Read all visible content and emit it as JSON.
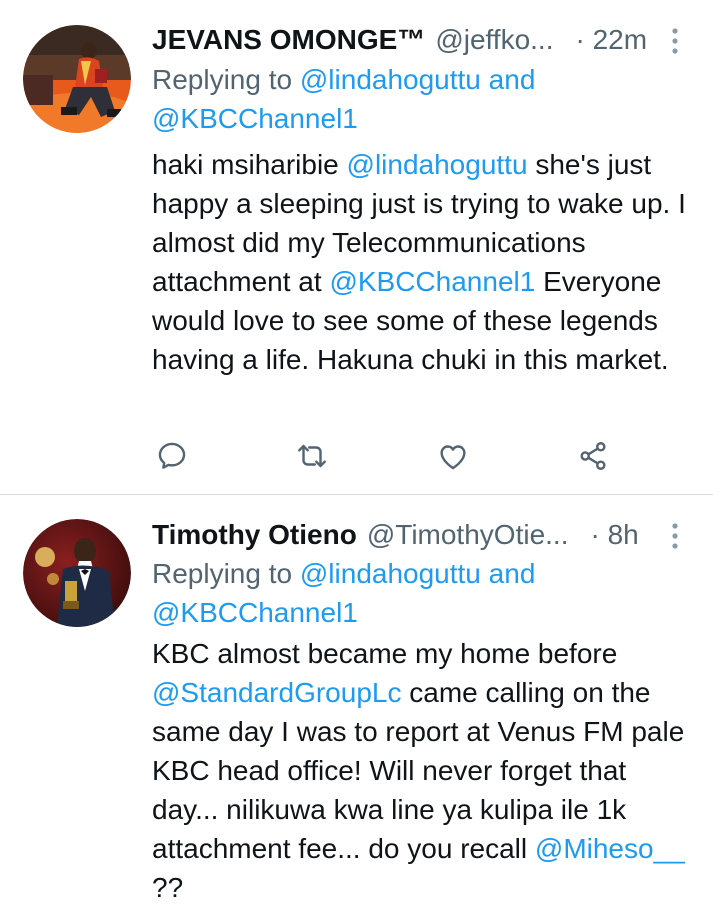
{
  "tweets": [
    {
      "display_name": "JEVANS OMONGE™",
      "handle": "@jeffko...",
      "timestamp": "· 22m",
      "reply_prefix": "Replying to ",
      "reply_mention_1": "@lindahoguttu",
      "reply_and": " and",
      "reply_mention_2": "@KBCChannel1",
      "body": [
        {
          "text": "haki msiharibie ",
          "mention": false
        },
        {
          "text": "@lindahoguttu",
          "mention": true
        },
        {
          "text": " she's just happy a sleeping just is trying to wake up. I almost did my Telecommunications attachment at ",
          "mention": false
        },
        {
          "text": "@KBCChannel1",
          "mention": true
        },
        {
          "text": " Everyone would love to see some of these legends having a life. Hakuna chuki in this market.",
          "mention": false
        }
      ],
      "actions": [
        "reply-icon",
        "retweet-icon",
        "like-icon",
        "share-icon"
      ]
    },
    {
      "display_name": "Timothy Otieno",
      "handle": "@TimothyOtie...",
      "timestamp": "· 8h",
      "reply_prefix": "Replying to ",
      "reply_mention_1": "@lindahoguttu",
      "reply_and": " and",
      "reply_mention_2": "@KBCChannel1",
      "body": [
        {
          "text": "KBC almost became my home before ",
          "mention": false
        },
        {
          "text": "@StandardGroupLc",
          "mention": true
        },
        {
          "text": " came calling on the same day I was to report at Venus FM pale KBC head office! Will never forget that day... nilikuwa kwa line ya kulipa ile 1k attachment fee... do you recall ",
          "mention": false
        },
        {
          "text": "@Miheso__",
          "mention": true
        },
        {
          "text": " ??",
          "mention": false
        }
      ]
    }
  ],
  "colors": {
    "text": "#0f1419",
    "secondary": "#536471",
    "link": "#1d9bf0",
    "divider": "#d9dee2"
  }
}
